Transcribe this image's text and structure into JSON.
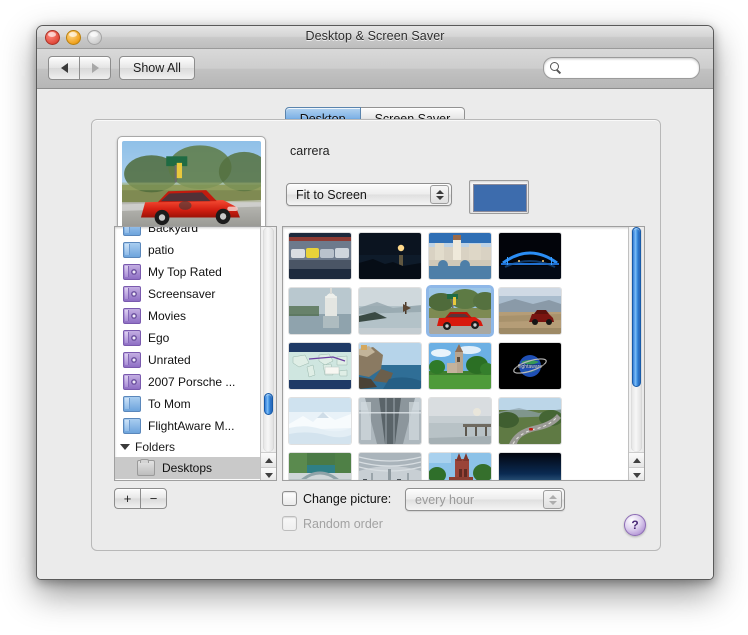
{
  "window": {
    "title": "Desktop & Screen Saver",
    "traffic_lights": [
      "close",
      "minimize",
      "zoom"
    ]
  },
  "toolbar": {
    "back_label": "back",
    "forward_label": "forward",
    "show_all_label": "Show All",
    "search_placeholder": "",
    "search_value": ""
  },
  "tabs": [
    {
      "label": "Desktop",
      "active": true
    },
    {
      "label": "Screen Saver",
      "active": false
    }
  ],
  "preview": {
    "image_name": "carrera",
    "alt": "red Porsche Carrera convertible on roadside"
  },
  "fit_popup": {
    "value": "Fit to Screen"
  },
  "color_well": {
    "color": "#3d6cad"
  },
  "sidebar": {
    "items": [
      {
        "label": "Backyard",
        "icon": "folder-blue-icon",
        "partial": true,
        "selected": false
      },
      {
        "label": "patio",
        "icon": "folder-blue-icon",
        "partial": false,
        "selected": false
      },
      {
        "label": "My Top Rated",
        "icon": "smart-folder-icon",
        "partial": false,
        "selected": false
      },
      {
        "label": "Screensaver",
        "icon": "smart-folder-icon",
        "partial": false,
        "selected": false
      },
      {
        "label": "Movies",
        "icon": "smart-folder-icon",
        "partial": false,
        "selected": false
      },
      {
        "label": "Ego",
        "icon": "smart-folder-icon",
        "partial": false,
        "selected": false
      },
      {
        "label": "Unrated",
        "icon": "smart-folder-icon",
        "partial": false,
        "selected": false
      },
      {
        "label": "2007 Porsche ...",
        "icon": "smart-folder-icon",
        "partial": false,
        "selected": false
      },
      {
        "label": "To Mom",
        "icon": "folder-blue-icon",
        "partial": false,
        "selected": false
      },
      {
        "label": "FlightAware M...",
        "icon": "folder-blue-icon",
        "partial": false,
        "selected": false
      }
    ],
    "group": {
      "label": "Folders",
      "expanded": true
    },
    "group_items": [
      {
        "label": "Desktops",
        "icon": "folder-plain-icon",
        "selected": true
      }
    ],
    "add_label": "+",
    "remove_label": "−",
    "scroll_position_pct": 82
  },
  "grid": {
    "scroll_position_pct": 0,
    "thumb_size_pct": 70,
    "thumbnails": [
      {
        "name": "parking-lot-cars",
        "selected": false
      },
      {
        "name": "moonlit-sea",
        "selected": false
      },
      {
        "name": "stone-bridge-town",
        "selected": false
      },
      {
        "name": "blue-lit-bridge",
        "selected": false
      },
      {
        "name": "capitol-reflection",
        "selected": false
      },
      {
        "name": "coastal-seascape",
        "selected": false
      },
      {
        "name": "red-porsche-carrera",
        "selected": true
      },
      {
        "name": "car-desert-overlook",
        "selected": false
      },
      {
        "name": "world-map",
        "selected": false
      },
      {
        "name": "cliffside-coast",
        "selected": false
      },
      {
        "name": "church-green-lawn",
        "selected": false
      },
      {
        "name": "globe-logo-black",
        "selected": false
      },
      {
        "name": "snowy-mountains",
        "selected": false
      },
      {
        "name": "bridge-walkway",
        "selected": false
      },
      {
        "name": "misty-pier",
        "selected": false
      },
      {
        "name": "winding-road",
        "selected": false
      },
      {
        "name": "arch-bridge-river",
        "selected": false
      },
      {
        "name": "station-interior",
        "selected": false
      },
      {
        "name": "cathedral-river",
        "selected": false
      },
      {
        "name": "sunset-gradient",
        "selected": false
      }
    ]
  },
  "options": {
    "change_picture_label": "Change picture:",
    "change_picture_checked": false,
    "interval_value": "every hour",
    "interval_enabled": false,
    "random_order_label": "Random order",
    "random_order_checked": false,
    "random_order_enabled": false
  },
  "help": {
    "label": "?"
  }
}
